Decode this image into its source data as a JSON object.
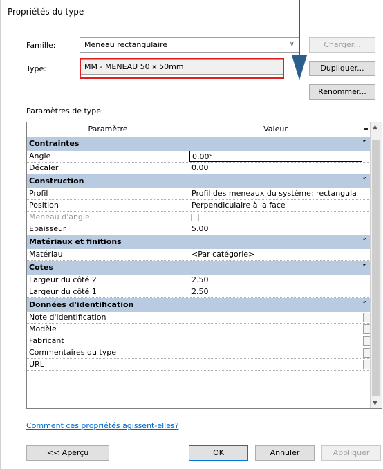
{
  "dialog": {
    "title": "Propriétés du type",
    "family_label": "Famille:",
    "family_value": "Meneau rectangulaire",
    "type_label": "Type:",
    "type_value": "MM  - MENEAU 50 x 50mm",
    "load_button": "Charger...",
    "duplicate_button": "Dupliquer...",
    "rename_button": "Renommer...",
    "params_label": "Paramètres de type",
    "help_link": "Comment ces propriétés agissent-elles?",
    "preview_button": "<< Aperçu",
    "ok_button": "OK",
    "cancel_button": "Annuler",
    "apply_button": "Appliquer"
  },
  "grid": {
    "col_param": "Paramètre",
    "col_value": "Valeur",
    "col_eq": "=",
    "groups": [
      {
        "name": "Contraintes",
        "rows": [
          {
            "param": "Angle",
            "value": "0.00°",
            "active": true
          },
          {
            "param": "Décaler",
            "value": "0.00"
          }
        ]
      },
      {
        "name": "Construction",
        "rows": [
          {
            "param": "Profil",
            "value": "Profil des meneaux du système: rectangula"
          },
          {
            "param": "Position",
            "value": "Perpendiculaire à la face"
          },
          {
            "param": "Meneau d'angle",
            "value": "",
            "checkbox": true,
            "disabled": true
          },
          {
            "param": "Epaisseur",
            "value": "5.00"
          }
        ]
      },
      {
        "name": "Matériaux et finitions",
        "rows": [
          {
            "param": "Matériau",
            "value": "<Par catégorie>"
          }
        ]
      },
      {
        "name": "Cotes",
        "rows": [
          {
            "param": "Largeur du côté 2",
            "value": "2.50"
          },
          {
            "param": "Largeur du côté 1",
            "value": "2.50"
          }
        ]
      },
      {
        "name": "Données d'identification",
        "rows": [
          {
            "param": "Note d'identification",
            "value": "",
            "box": true
          },
          {
            "param": "Modèle",
            "value": "",
            "box": true
          },
          {
            "param": "Fabricant",
            "value": "",
            "box": true
          },
          {
            "param": "Commentaires du type",
            "value": "",
            "box": true
          },
          {
            "param": "URL",
            "value": "",
            "box": true
          }
        ]
      }
    ]
  },
  "colors": {
    "group_header": "#b9cbe0",
    "highlight": "#e02020",
    "arrow": "#2a5e8c",
    "link": "#0066cc"
  }
}
